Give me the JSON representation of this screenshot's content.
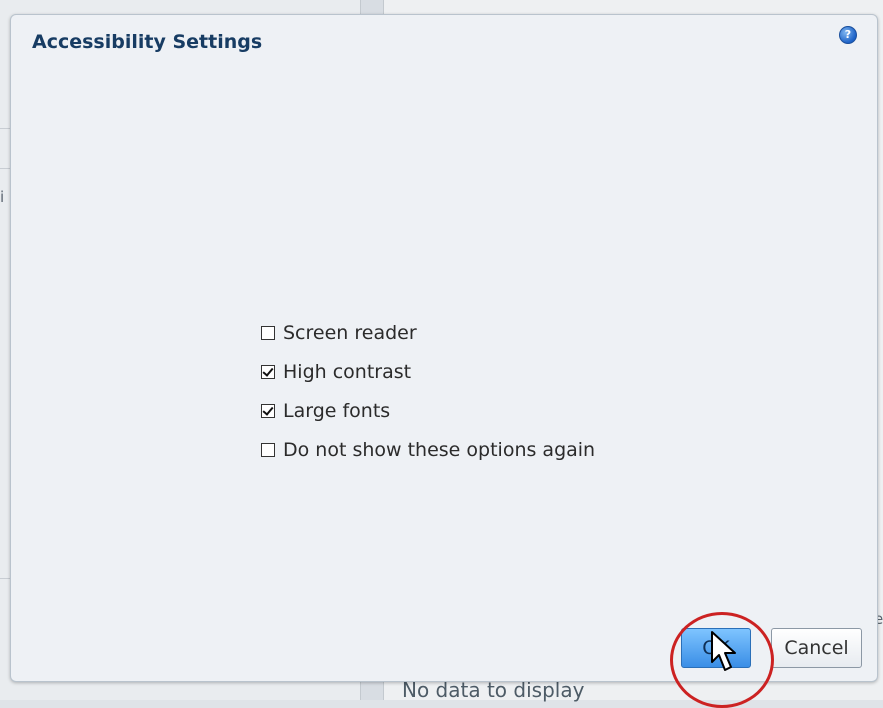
{
  "background": {
    "left_edge_text": "i",
    "right_edge_text": "e",
    "footer_text": "No data to display"
  },
  "dialog": {
    "title": "Accessibility Settings",
    "help_icon": "?",
    "options": [
      {
        "label": "Screen reader",
        "checked": false
      },
      {
        "label": "High contrast",
        "checked": true
      },
      {
        "label": "Large fonts",
        "checked": true
      },
      {
        "label": "Do not show these options again",
        "checked": false
      }
    ],
    "ok_label": "OK",
    "cancel_label": "Cancel"
  },
  "colors": {
    "title": "#173c63",
    "ok_button": "#3a8ee6",
    "highlight_ring": "#cc2222"
  },
  "icons": {
    "help": "help-icon",
    "cursor": "arrow-cursor-icon"
  }
}
